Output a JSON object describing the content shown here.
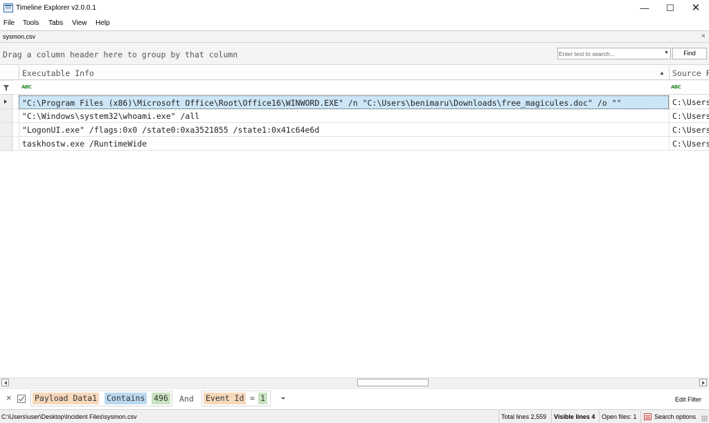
{
  "window": {
    "title": "Timeline Explorer v2.0.0.1",
    "min_glyph": "—",
    "max_glyph": "☐",
    "close_glyph": "✕"
  },
  "menu": [
    "File",
    "Tools",
    "Tabs",
    "View",
    "Help"
  ],
  "tab": {
    "label": "sysmon.csv",
    "close_glyph": "×"
  },
  "group_panel": {
    "text": "Drag a column header here to group by that column",
    "search_placeholder": "Enter text to search...",
    "find_label": "Find"
  },
  "grid": {
    "columns": [
      "Executable Info",
      "Source F"
    ],
    "sorted_column": "Executable Info",
    "sort_direction": "ascending",
    "filter_icon_text": "ABC",
    "rows": [
      {
        "info": "\"C:\\Program Files (x86)\\Microsoft Office\\Root\\Office16\\WINWORD.EXE\" /n \"C:\\Users\\benimaru\\Downloads\\free_magicules.doc\" /o \"\"",
        "source": "C:\\Users",
        "selected": true
      },
      {
        "info": "\"C:\\Windows\\system32\\whoami.exe\" /all",
        "source": "C:\\Users",
        "selected": false
      },
      {
        "info": "\"LogonUI.exe\" /flags:0x0 /state0:0xa3521855 /state1:0x41c64e6d",
        "source": "C:\\Users",
        "selected": false
      },
      {
        "info": "taskhostw.exe /RuntimeWide",
        "source": "C:\\Users",
        "selected": false
      }
    ]
  },
  "filter_bar": {
    "clear_glyph": "×",
    "enabled": true,
    "condition1": {
      "field": "Payload Data1",
      "operator": "Contains",
      "value": "496"
    },
    "conjunction": "And",
    "condition2": {
      "field": "Event Id",
      "operator": "=",
      "value": "1"
    },
    "edit_label": "Edit Filter"
  },
  "status": {
    "path": "C:\\Users\\user\\Desktop\\Incident Files\\sysmon.csv",
    "total_lines": "Total lines 2,559",
    "visible_lines": "Visible lines 4",
    "open_files": "Open files: 1",
    "search_options": "Search options"
  },
  "colors": {
    "selected_row": "#cde6f7",
    "token_field": "#f7d8bb",
    "token_operator": "#bcd8ee",
    "token_value": "#c9e2c0"
  }
}
